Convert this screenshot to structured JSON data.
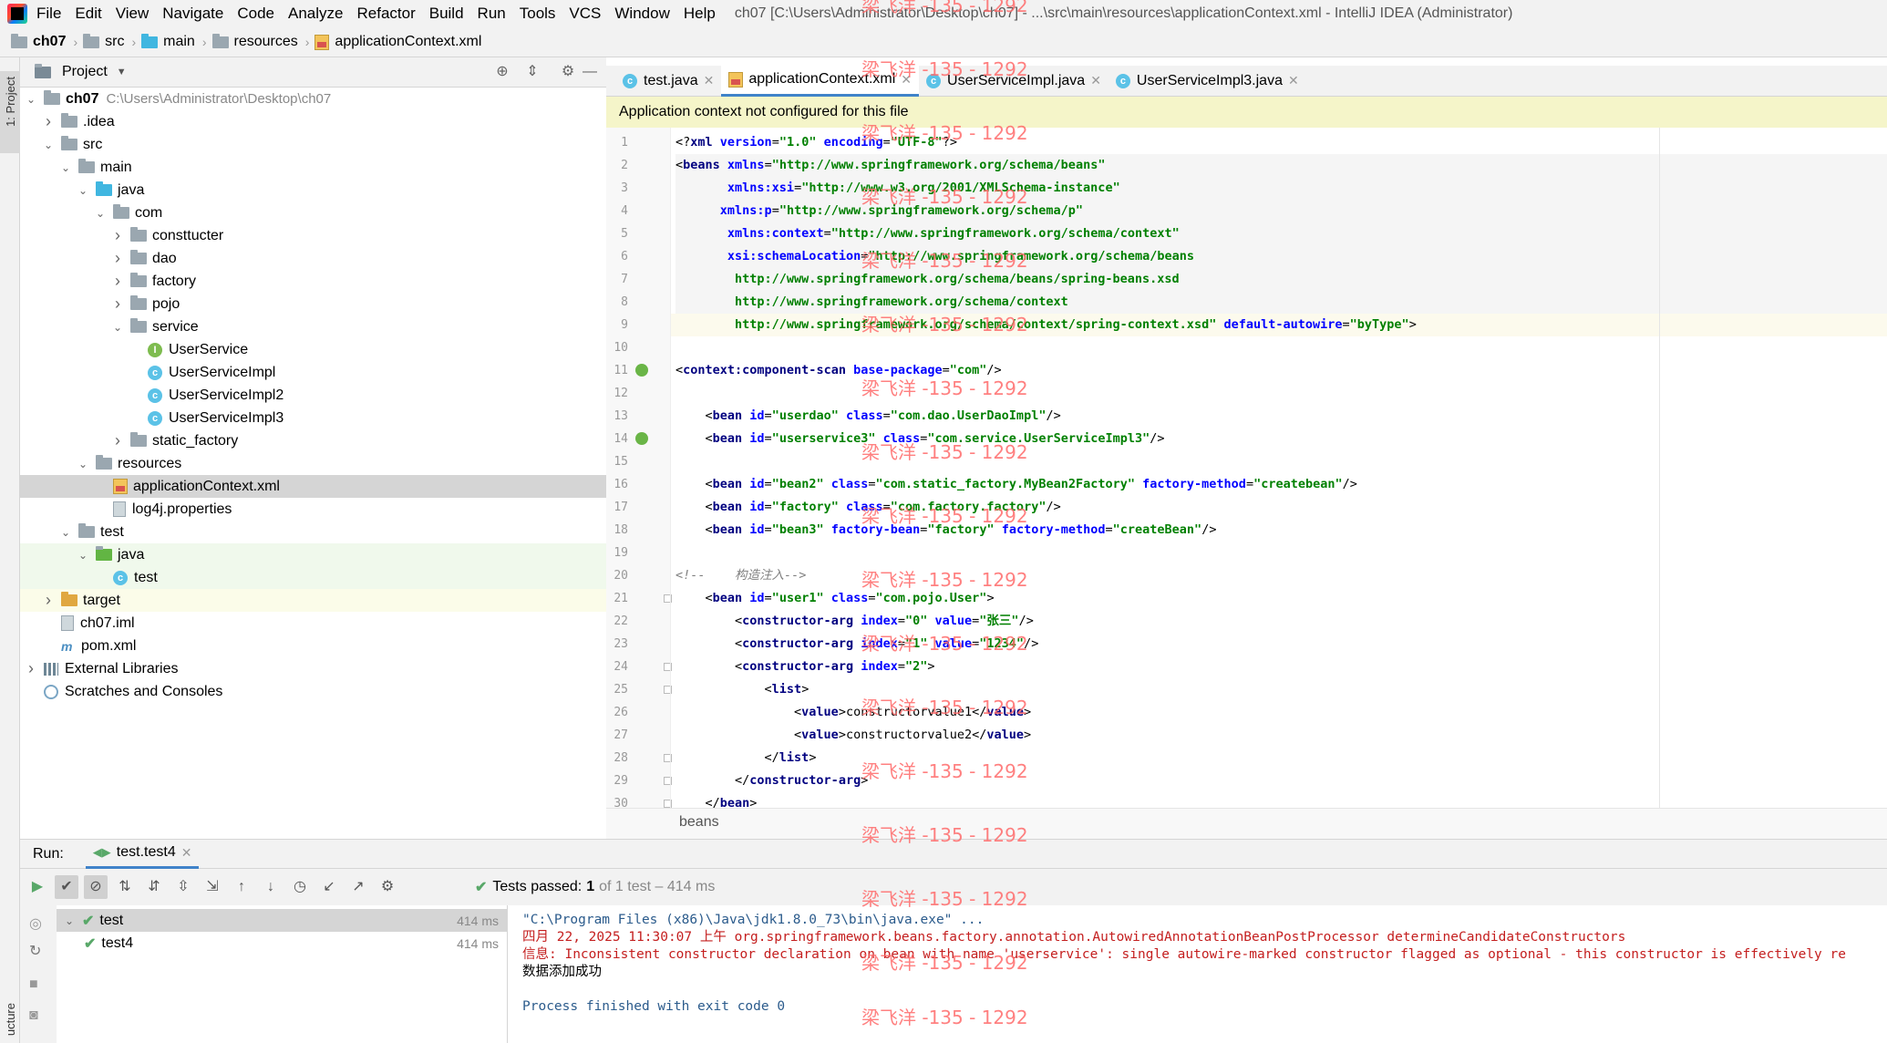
{
  "menu": {
    "items": [
      "File",
      "Edit",
      "View",
      "Navigate",
      "Code",
      "Analyze",
      "Refactor",
      "Build",
      "Run",
      "Tools",
      "VCS",
      "Window",
      "Help"
    ],
    "window_title": "ch07 [C:\\Users\\Administrator\\Desktop\\ch07] - ...\\src\\main\\resources\\applicationContext.xml - IntelliJ IDEA (Administrator)"
  },
  "breadcrumb": [
    "ch07",
    "src",
    "main",
    "resources",
    "applicationContext.xml"
  ],
  "left_strip": {
    "project_label": "1: Project",
    "structure_label": "ucture"
  },
  "project_panel": {
    "title": "Project",
    "tree": [
      {
        "label": "ch07",
        "path": "C:\\Users\\Administrator\\Desktop\\ch07",
        "depth": 0,
        "icon": "folder",
        "arrow": "down",
        "bold": true
      },
      {
        "label": ".idea",
        "depth": 1,
        "icon": "folder",
        "arrow": "right"
      },
      {
        "label": "src",
        "depth": 1,
        "icon": "folder",
        "arrow": "down"
      },
      {
        "label": "main",
        "depth": 2,
        "icon": "folder",
        "arrow": "down"
      },
      {
        "label": "java",
        "depth": 3,
        "icon": "folder-blue",
        "arrow": "down"
      },
      {
        "label": "com",
        "depth": 4,
        "icon": "folder",
        "arrow": "down"
      },
      {
        "label": "consttucter",
        "depth": 5,
        "icon": "folder",
        "arrow": "right"
      },
      {
        "label": "dao",
        "depth": 5,
        "icon": "folder",
        "arrow": "right"
      },
      {
        "label": "factory",
        "depth": 5,
        "icon": "folder",
        "arrow": "right"
      },
      {
        "label": "pojo",
        "depth": 5,
        "icon": "folder",
        "arrow": "right"
      },
      {
        "label": "service",
        "depth": 5,
        "icon": "folder",
        "arrow": "down"
      },
      {
        "label": "UserService",
        "depth": 6,
        "icon": "interface",
        "arrow": ""
      },
      {
        "label": "UserServiceImpl",
        "depth": 6,
        "icon": "class",
        "arrow": ""
      },
      {
        "label": "UserServiceImpl2",
        "depth": 6,
        "icon": "class",
        "arrow": ""
      },
      {
        "label": "UserServiceImpl3",
        "depth": 6,
        "icon": "class",
        "arrow": ""
      },
      {
        "label": "static_factory",
        "depth": 5,
        "icon": "folder",
        "arrow": "right"
      },
      {
        "label": "resources",
        "depth": 3,
        "icon": "folder",
        "arrow": "down"
      },
      {
        "label": "applicationContext.xml",
        "depth": 4,
        "icon": "xml",
        "arrow": "",
        "selected": true
      },
      {
        "label": "log4j.properties",
        "depth": 4,
        "icon": "file",
        "arrow": ""
      },
      {
        "label": "test",
        "depth": 2,
        "icon": "folder",
        "arrow": "down"
      },
      {
        "label": "java",
        "depth": 3,
        "icon": "folder-green",
        "arrow": "down",
        "bg": "green"
      },
      {
        "label": "test",
        "depth": 4,
        "icon": "class",
        "arrow": "",
        "bg": "green"
      },
      {
        "label": "target",
        "depth": 1,
        "icon": "folder-orange",
        "arrow": "right",
        "bg": "yellow"
      },
      {
        "label": "ch07.iml",
        "depth": 1,
        "icon": "file",
        "arrow": ""
      },
      {
        "label": "pom.xml",
        "depth": 1,
        "icon": "maven",
        "arrow": ""
      },
      {
        "label": "External Libraries",
        "depth": 0,
        "icon": "lib",
        "arrow": "right"
      },
      {
        "label": "Scratches and Consoles",
        "depth": 0,
        "icon": "scratch",
        "arrow": ""
      }
    ]
  },
  "editor_tabs": [
    {
      "label": "test.java",
      "icon": "class",
      "active": false
    },
    {
      "label": "applicationContext.xml",
      "icon": "xml",
      "active": true
    },
    {
      "label": "UserServiceImpl.java",
      "icon": "class",
      "active": false
    },
    {
      "label": "UserServiceImpl3.java",
      "icon": "class",
      "active": false
    }
  ],
  "notification": "Application context not configured for this file",
  "code_lines": [
    {
      "n": "1",
      "tokens": [
        [
          "t",
          "<?"
        ],
        [
          "k",
          "xml "
        ],
        [
          "a",
          "version"
        ],
        [
          "t",
          "="
        ],
        [
          "s",
          "\"1.0\""
        ],
        [
          "t",
          " "
        ],
        [
          "a",
          "encoding"
        ],
        [
          "t",
          "="
        ],
        [
          "s",
          "\"UTF-8\""
        ],
        [
          "t",
          "?>"
        ]
      ]
    },
    {
      "n": "2",
      "hl": true,
      "tokens": [
        [
          "t",
          "<"
        ],
        [
          "k",
          "beans "
        ],
        [
          "a",
          "xmlns"
        ],
        [
          "t",
          "="
        ],
        [
          "s",
          "\"http://www.springframework.org/schema/beans\""
        ]
      ]
    },
    {
      "n": "3",
      "hl": true,
      "tokens": [
        [
          "t",
          "       "
        ],
        [
          "a",
          "xmlns:xsi"
        ],
        [
          "t",
          "="
        ],
        [
          "s",
          "\"http://www.w3.org/2001/XMLSchema-instance\""
        ]
      ]
    },
    {
      "n": "4",
      "hl": true,
      "tokens": [
        [
          "t",
          "      "
        ],
        [
          "a",
          "xmlns:p"
        ],
        [
          "t",
          "="
        ],
        [
          "s",
          "\"http://www.springframework.org/schema/p\""
        ]
      ]
    },
    {
      "n": "5",
      "hl": true,
      "tokens": [
        [
          "t",
          "       "
        ],
        [
          "a",
          "xmlns:context"
        ],
        [
          "t",
          "="
        ],
        [
          "s",
          "\"http://www.springframework.org/schema/context\""
        ]
      ]
    },
    {
      "n": "6",
      "hl": true,
      "tokens": [
        [
          "t",
          "       "
        ],
        [
          "a",
          "xsi:schemaLocation"
        ],
        [
          "t",
          "="
        ],
        [
          "s",
          "\"http://www.springframework.org/schema/beans"
        ]
      ]
    },
    {
      "n": "7",
      "hl": true,
      "tokens": [
        [
          "s",
          "        http://www.springframework.org/schema/beans/spring-beans.xsd"
        ]
      ]
    },
    {
      "n": "8",
      "hl": true,
      "tokens": [
        [
          "s",
          "        http://www.springframework.org/schema/context"
        ]
      ]
    },
    {
      "n": "9",
      "caret": true,
      "tokens": [
        [
          "s",
          "        http://www.springframework.org/schema/context/spring-context.xsd\""
        ],
        [
          "t",
          " "
        ],
        [
          "a",
          "default-autowire"
        ],
        [
          "t",
          "="
        ],
        [
          "s",
          "\"byType\""
        ],
        [
          "t",
          ">"
        ]
      ]
    },
    {
      "n": "10",
      "tokens": []
    },
    {
      "n": "11",
      "mark": true,
      "tokens": [
        [
          "t",
          "<"
        ],
        [
          "k",
          "context:component-scan "
        ],
        [
          "a",
          "base-package"
        ],
        [
          "t",
          "="
        ],
        [
          "s",
          "\"com\""
        ],
        [
          "t",
          "/>"
        ]
      ]
    },
    {
      "n": "12",
      "tokens": []
    },
    {
      "n": "13",
      "tokens": [
        [
          "t",
          "    <"
        ],
        [
          "k",
          "bean "
        ],
        [
          "a",
          "id"
        ],
        [
          "t",
          "="
        ],
        [
          "s",
          "\"userdao\""
        ],
        [
          "t",
          " "
        ],
        [
          "a",
          "class"
        ],
        [
          "t",
          "="
        ],
        [
          "s",
          "\"com.dao.UserDaoImpl\""
        ],
        [
          "t",
          "/>"
        ]
      ]
    },
    {
      "n": "14",
      "mark": true,
      "tokens": [
        [
          "t",
          "    <"
        ],
        [
          "k",
          "bean "
        ],
        [
          "a",
          "id"
        ],
        [
          "t",
          "="
        ],
        [
          "s",
          "\"userservice3\""
        ],
        [
          "t",
          " "
        ],
        [
          "a",
          "class"
        ],
        [
          "t",
          "="
        ],
        [
          "s",
          "\"com.service.UserServiceImpl3\""
        ],
        [
          "t",
          "/>"
        ]
      ]
    },
    {
      "n": "15",
      "tokens": []
    },
    {
      "n": "16",
      "tokens": [
        [
          "t",
          "    <"
        ],
        [
          "k",
          "bean "
        ],
        [
          "a",
          "id"
        ],
        [
          "t",
          "="
        ],
        [
          "s",
          "\"bean2\""
        ],
        [
          "t",
          " "
        ],
        [
          "a",
          "class"
        ],
        [
          "t",
          "="
        ],
        [
          "s",
          "\"com.static_factory.MyBean2Factory\""
        ],
        [
          "t",
          " "
        ],
        [
          "a",
          "factory-method"
        ],
        [
          "t",
          "="
        ],
        [
          "s",
          "\"createbean\""
        ],
        [
          "t",
          "/>"
        ]
      ]
    },
    {
      "n": "17",
      "tokens": [
        [
          "t",
          "    <"
        ],
        [
          "k",
          "bean "
        ],
        [
          "a",
          "id"
        ],
        [
          "t",
          "="
        ],
        [
          "s",
          "\"factory\""
        ],
        [
          "t",
          " "
        ],
        [
          "a",
          "class"
        ],
        [
          "t",
          "="
        ],
        [
          "s",
          "\"com.factory.factory\""
        ],
        [
          "t",
          "/>"
        ]
      ]
    },
    {
      "n": "18",
      "tokens": [
        [
          "t",
          "    <"
        ],
        [
          "k",
          "bean "
        ],
        [
          "a",
          "id"
        ],
        [
          "t",
          "="
        ],
        [
          "s",
          "\"bean3\""
        ],
        [
          "t",
          " "
        ],
        [
          "a",
          "factory-bean"
        ],
        [
          "t",
          "="
        ],
        [
          "s",
          "\"factory\""
        ],
        [
          "t",
          " "
        ],
        [
          "a",
          "factory-method"
        ],
        [
          "t",
          "="
        ],
        [
          "s",
          "\"createBean\""
        ],
        [
          "t",
          "/>"
        ]
      ]
    },
    {
      "n": "19",
      "tokens": []
    },
    {
      "n": "20",
      "tokens": [
        [
          "c",
          "<!--    构造注入-->"
        ]
      ]
    },
    {
      "n": "21",
      "fold": true,
      "tokens": [
        [
          "t",
          "    <"
        ],
        [
          "k",
          "bean "
        ],
        [
          "a",
          "id"
        ],
        [
          "t",
          "="
        ],
        [
          "s",
          "\"user1\""
        ],
        [
          "t",
          " "
        ],
        [
          "a",
          "class"
        ],
        [
          "t",
          "="
        ],
        [
          "s",
          "\"com.pojo.User\""
        ],
        [
          "t",
          ">"
        ]
      ]
    },
    {
      "n": "22",
      "tokens": [
        [
          "t",
          "        <"
        ],
        [
          "k",
          "constructor-arg "
        ],
        [
          "a",
          "index"
        ],
        [
          "t",
          "="
        ],
        [
          "s",
          "\"0\""
        ],
        [
          "t",
          " "
        ],
        [
          "a",
          "value"
        ],
        [
          "t",
          "="
        ],
        [
          "s",
          "\"张三\""
        ],
        [
          "t",
          "/>"
        ]
      ]
    },
    {
      "n": "23",
      "tokens": [
        [
          "t",
          "        <"
        ],
        [
          "k",
          "constructor-arg "
        ],
        [
          "a",
          "index"
        ],
        [
          "t",
          "="
        ],
        [
          "s",
          "\"1\""
        ],
        [
          "t",
          " "
        ],
        [
          "a",
          "value"
        ],
        [
          "t",
          "="
        ],
        [
          "s",
          "\"1234\""
        ],
        [
          "t",
          "/>"
        ]
      ]
    },
    {
      "n": "24",
      "fold": true,
      "tokens": [
        [
          "t",
          "        <"
        ],
        [
          "k",
          "constructor-arg "
        ],
        [
          "a",
          "index"
        ],
        [
          "t",
          "="
        ],
        [
          "s",
          "\"2\""
        ],
        [
          "t",
          ">"
        ]
      ]
    },
    {
      "n": "25",
      "fold": true,
      "tokens": [
        [
          "t",
          "            <"
        ],
        [
          "k",
          "list"
        ],
        [
          "t",
          ">"
        ]
      ]
    },
    {
      "n": "26",
      "tokens": [
        [
          "t",
          "                <"
        ],
        [
          "k",
          "value"
        ],
        [
          "t",
          ">constructorvalue1</"
        ],
        [
          "k",
          "value"
        ],
        [
          "t",
          ">"
        ]
      ]
    },
    {
      "n": "27",
      "tokens": [
        [
          "t",
          "                <"
        ],
        [
          "k",
          "value"
        ],
        [
          "t",
          ">constructorvalue2</"
        ],
        [
          "k",
          "value"
        ],
        [
          "t",
          ">"
        ]
      ]
    },
    {
      "n": "28",
      "fold": true,
      "tokens": [
        [
          "t",
          "            </"
        ],
        [
          "k",
          "list"
        ],
        [
          "t",
          ">"
        ]
      ]
    },
    {
      "n": "29",
      "fold": true,
      "tokens": [
        [
          "t",
          "        </"
        ],
        [
          "k",
          "constructor-arg"
        ],
        [
          "t",
          ">"
        ]
      ]
    },
    {
      "n": "30",
      "fold": true,
      "tokens": [
        [
          "t",
          "    </"
        ],
        [
          "k",
          "bean"
        ],
        [
          "t",
          ">"
        ]
      ]
    }
  ],
  "editor_footer": "beans",
  "run": {
    "label": "Run:",
    "tab": "test.test4",
    "status_prefix": "Tests passed:",
    "status_count": "1",
    "status_suffix": "of 1 test – 414 ms",
    "tree": [
      {
        "label": "test",
        "time": "414 ms",
        "depth": 0
      },
      {
        "label": "test4",
        "time": "414 ms",
        "depth": 1
      }
    ],
    "console": [
      {
        "text": "\"C:\\Program Files (x86)\\Java\\jdk1.8.0_73\\bin\\java.exe\" ...",
        "color": "#2b5b8c"
      },
      {
        "text": "四月 22, 2025 11:30:07 上午 org.springframework.beans.factory.annotation.AutowiredAnnotationBeanPostProcessor determineCandidateConstructors",
        "color": "#c41e1e"
      },
      {
        "text": "信息: Inconsistent constructor declaration on bean with name 'userservice': single autowire-marked constructor flagged as optional - this constructor is effectively re",
        "color": "#c41e1e"
      },
      {
        "text": "数据添加成功",
        "color": "#000000"
      },
      {
        "text": "",
        "color": "#000000"
      },
      {
        "text": "Process finished with exit code 0",
        "color": "#2b5b8c"
      }
    ]
  },
  "watermark": "梁飞洋 -135 - 1292",
  "colors": {
    "accent": "#4083c9",
    "string": "#008000",
    "keyword": "#000080",
    "attribute": "#0000ff",
    "pass": "#59a869"
  }
}
